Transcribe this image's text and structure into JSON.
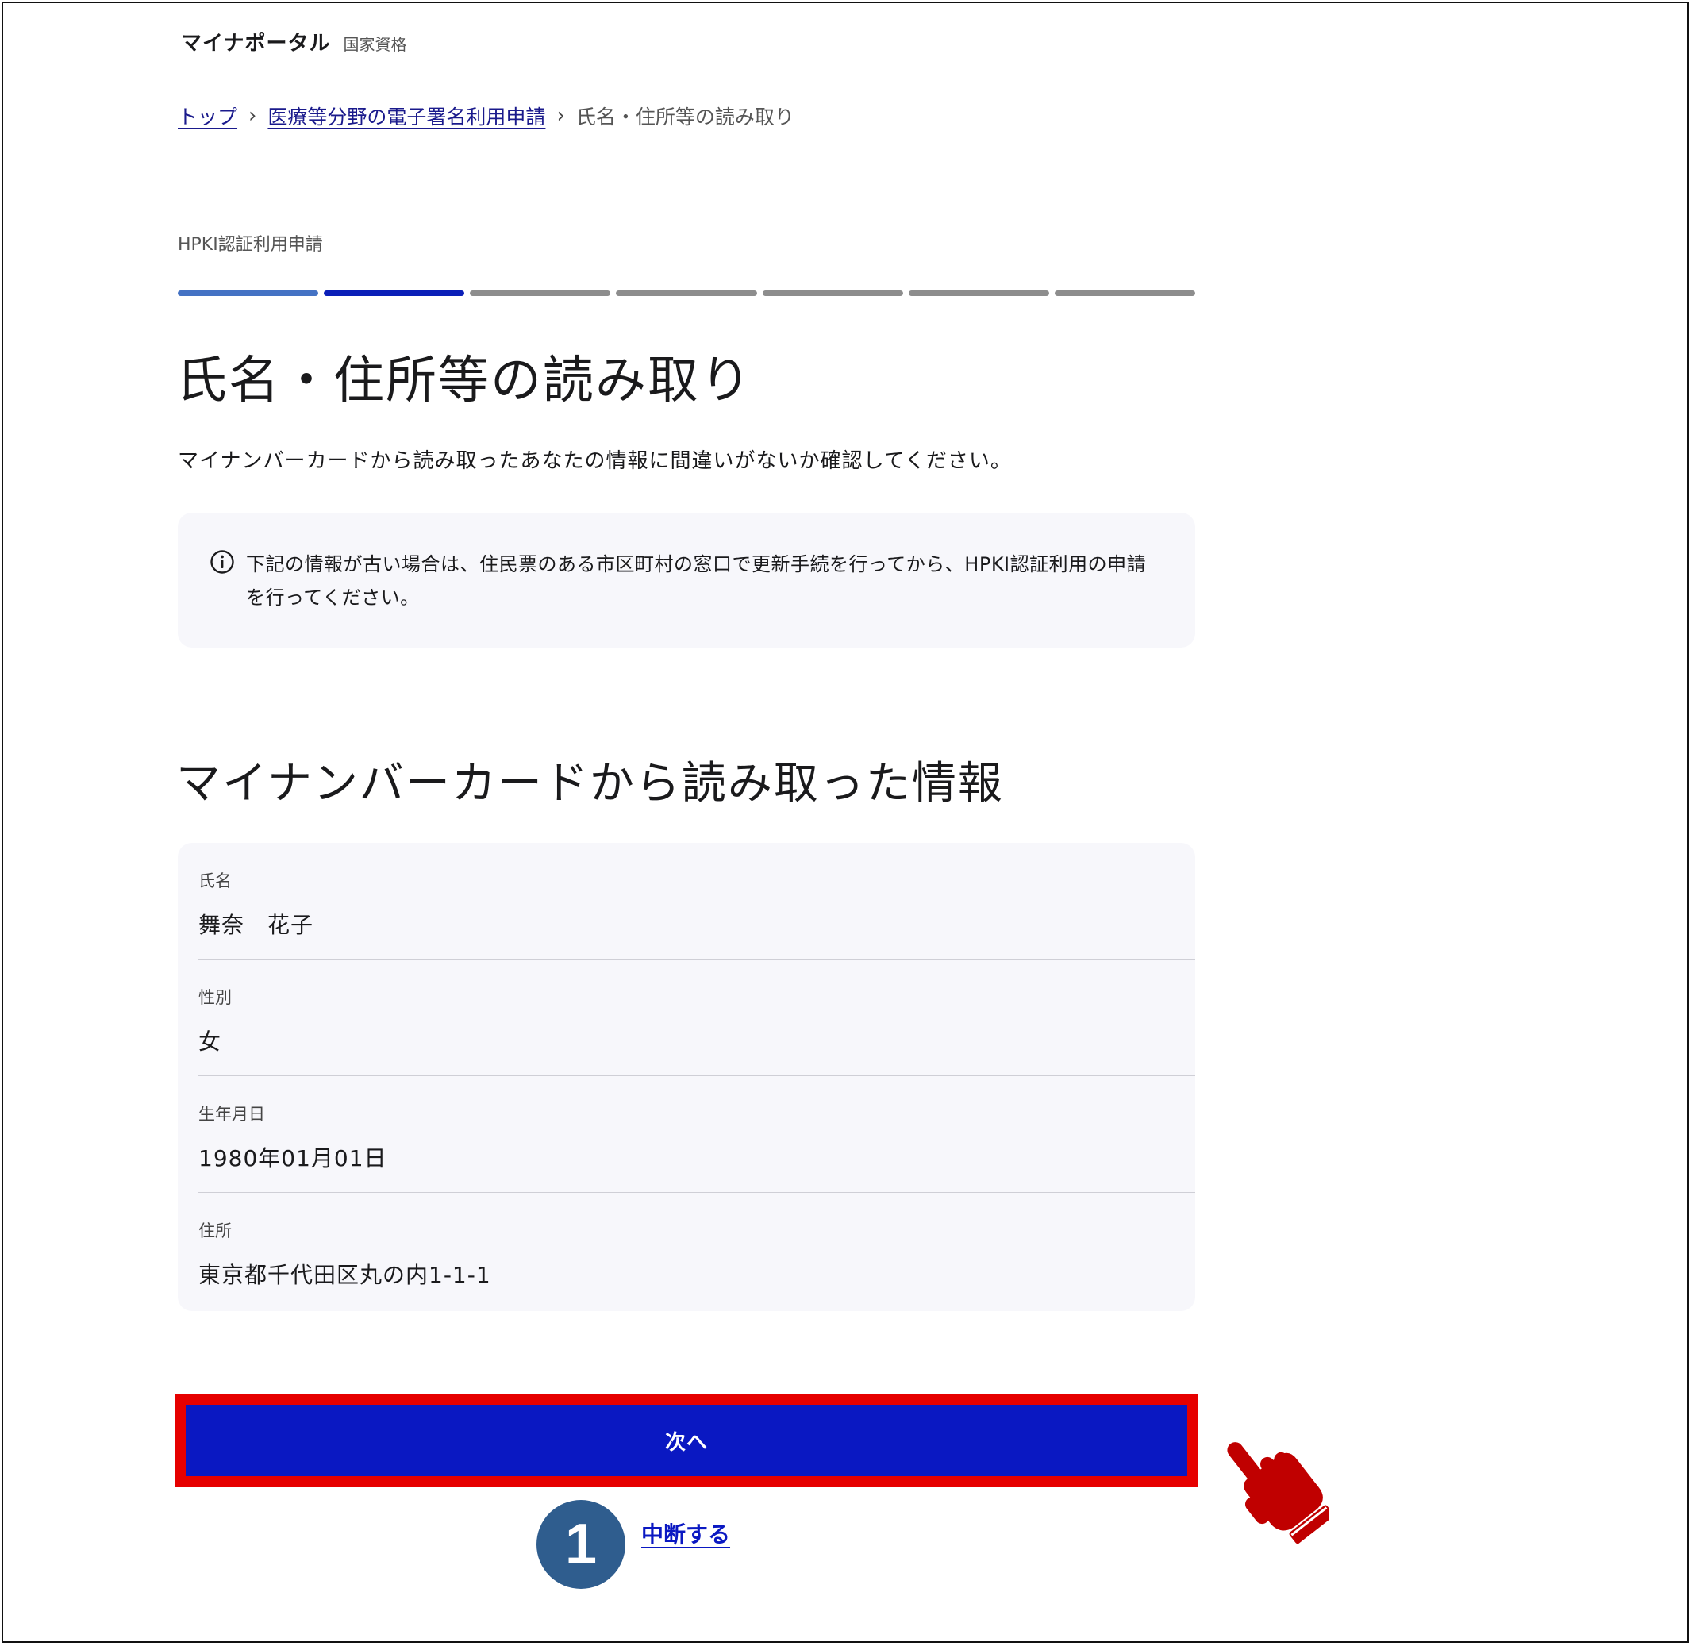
{
  "header": {
    "brand": "マイナポータル",
    "sub": "国家資格"
  },
  "breadcrumb": {
    "top": "トップ",
    "parent": "医療等分野の電子署名利用申請",
    "current": "氏名・住所等の読み取り",
    "separator": "›"
  },
  "progress": {
    "label": "HPKI認証利用申請",
    "total_steps": 7,
    "current_step": 2
  },
  "page": {
    "title": "氏名・住所等の読み取り",
    "lead": "マイナンバーカードから読み取ったあなたの情報に間違いがないか確認してください。"
  },
  "notice": {
    "icon": "info-icon",
    "text": "下記の情報が古い場合は、住民票のある市区町村の窓口で更新手続を行ってから、HPKI認証利用の申請を行ってください。"
  },
  "card_info": {
    "title": "マイナンバーカードから読み取った情報",
    "fields": [
      {
        "label": "氏名",
        "value": "舞奈　花子"
      },
      {
        "label": "性別",
        "value": "女"
      },
      {
        "label": "生年月日",
        "value": "1980年01月01日"
      },
      {
        "label": "住所",
        "value": "東京都千代田区丸の内1-1-1"
      }
    ]
  },
  "actions": {
    "next_label": "次へ",
    "cancel_label": "中断する"
  },
  "annotation": {
    "step_number": "1",
    "highlight_color": "#e60000",
    "pointer_icon": "pointing-hand-icon",
    "pointer_color": "#c00000"
  },
  "colors": {
    "primary": "#0a18c2",
    "progress_done": "#4472c4",
    "progress_current": "#0b1fb8",
    "progress_pending": "#8d8d8d",
    "panel_bg": "#f7f7fb"
  }
}
